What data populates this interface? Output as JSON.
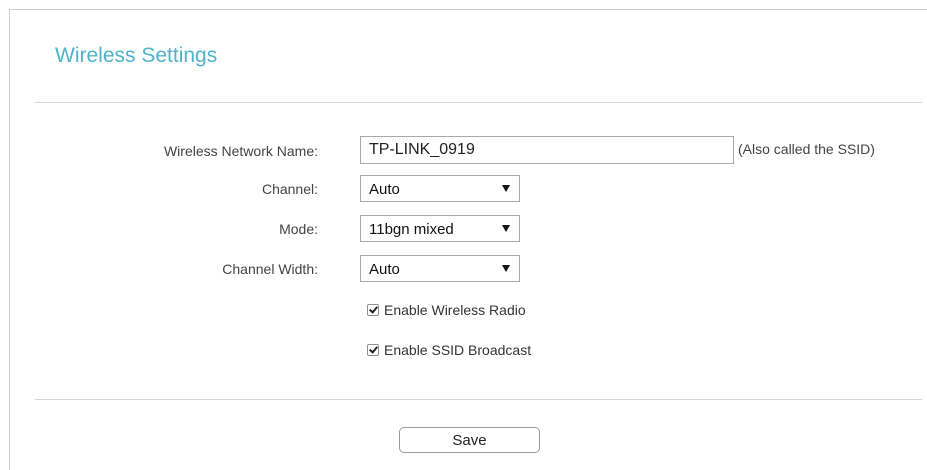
{
  "page": {
    "title": "Wireless Settings",
    "accent_color": "#4fb3c9"
  },
  "form": {
    "network_name": {
      "label": "Wireless Network Name:",
      "value": "TP-LINK_0919",
      "hint": "(Also called the SSID)"
    },
    "channel": {
      "label": "Channel:",
      "selected": "Auto",
      "icon": "dropdown-arrow-icon"
    },
    "mode": {
      "label": "Mode:",
      "selected": "11bgn mixed",
      "icon": "dropdown-arrow-icon"
    },
    "channel_width": {
      "label": "Channel Width:",
      "selected": "Auto",
      "icon": "dropdown-arrow-icon"
    },
    "enable_radio": {
      "label": "Enable Wireless Radio",
      "checked": true
    },
    "enable_ssid_broadcast": {
      "label": "Enable SSID Broadcast",
      "checked": true
    }
  },
  "actions": {
    "save_label": "Save"
  }
}
